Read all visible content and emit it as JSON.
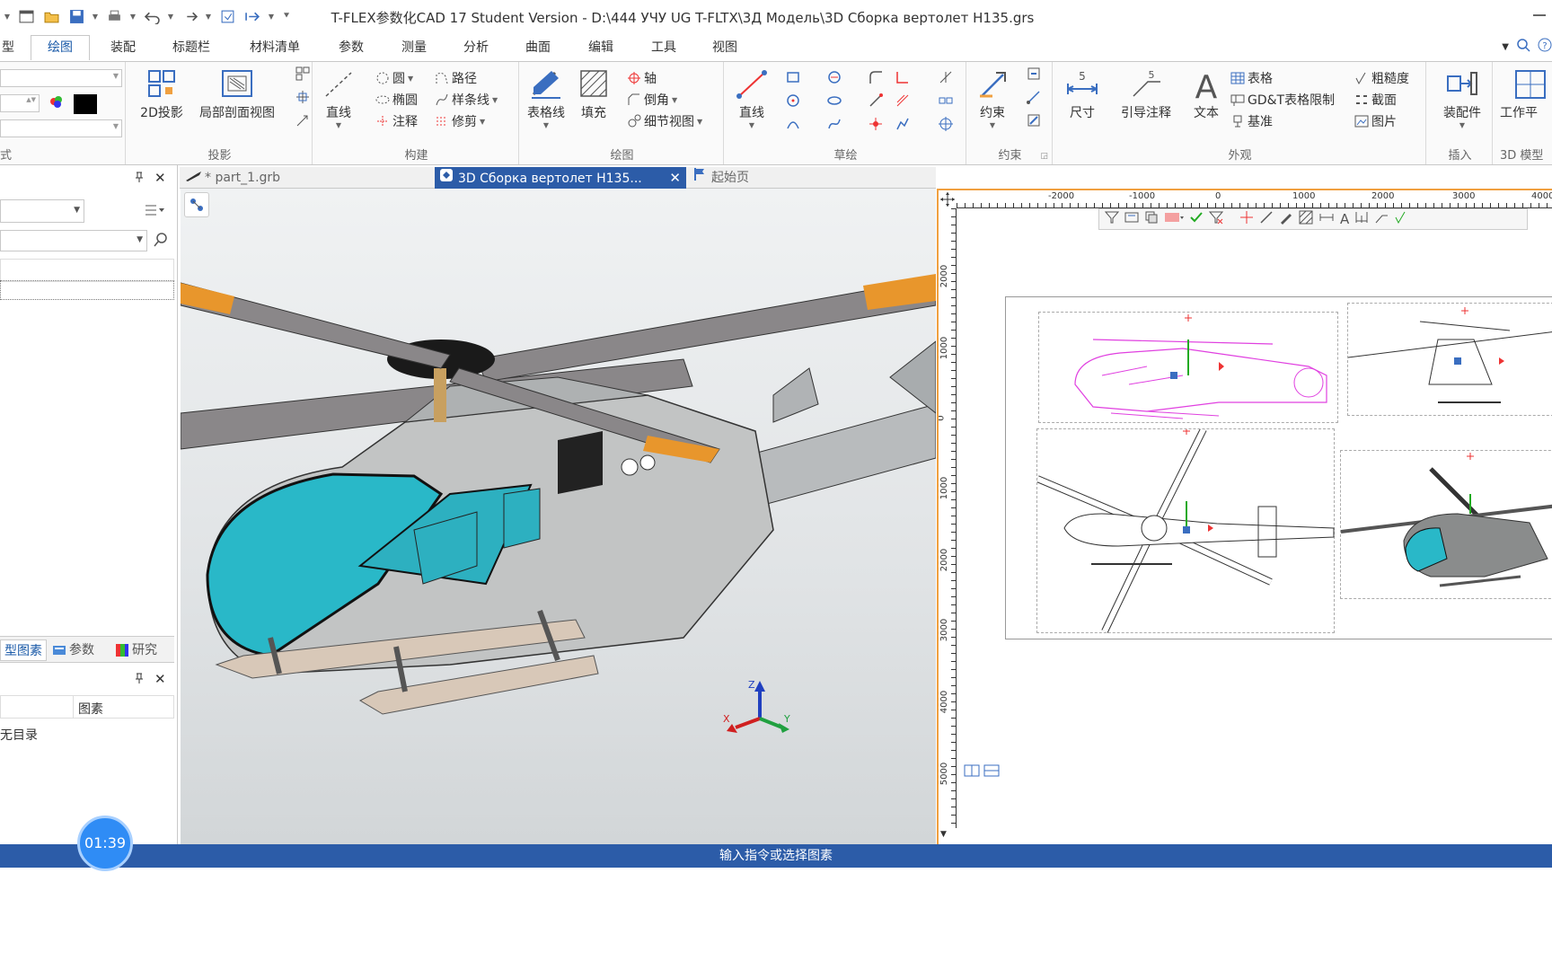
{
  "window": {
    "title": "T-FLEX参数化CAD 17 Student Version - D:\\444 УЧУ UG T-FLTX\\3Д Модель\\3D Сборка вертолет H135.grs"
  },
  "ribbon_tabs": [
    "型",
    "绘图",
    "装配",
    "标题栏",
    "材料清单",
    "参数",
    "测量",
    "分析",
    "曲面",
    "编辑",
    "工具",
    "视图"
  ],
  "ribbon": {
    "style_group": {
      "label": "式"
    },
    "projection": {
      "label": "投影",
      "btn_2d": "2D投影",
      "btn_section": "局部剖面视图"
    },
    "construct": {
      "label": "构建",
      "line": "直线",
      "circle": "圆",
      "ellipse": "椭圆",
      "annotation": "注释",
      "path": "路径",
      "spline": "样条线",
      "trim": "修剪"
    },
    "drawing": {
      "label": "绘图",
      "table_line": "表格线",
      "fill": "填充",
      "axis": "轴",
      "chamfer": "倒角",
      "detail_view": "细节视图"
    },
    "sketch": {
      "label": "草绘",
      "line": "直线"
    },
    "constraint": {
      "label": "约束",
      "btn": "约束"
    },
    "appearance": {
      "label": "外观",
      "dimension": "尺寸",
      "leader": "引导注释",
      "text": "文本",
      "table": "表格",
      "gdt": "GD&T表格限制",
      "datum": "基准",
      "roughness": "粗糙度",
      "section": "截面",
      "image": "图片"
    },
    "insert": {
      "label": "插入",
      "assembly": "装配件"
    },
    "model3d": {
      "label": "3D 模型",
      "workplane": "工作平"
    }
  },
  "doc_tabs": [
    {
      "label": "* part_1.grb",
      "active": false
    },
    {
      "label": "3D Сборка вертолет H135...",
      "active": true
    },
    {
      "label": "起始页",
      "active": false
    }
  ],
  "left_panel": {
    "bottom_tabs": [
      "型图素",
      "参数",
      "研究"
    ],
    "column_header": "图素",
    "empty_text": "无目录"
  },
  "ruler": {
    "h_ticks": [
      "-2000",
      "-1000",
      "0",
      "1000",
      "2000",
      "3000",
      "4000"
    ],
    "v_ticks": [
      "2000",
      "1000",
      "0",
      "1000",
      "2000",
      "3000",
      "4000",
      "5000"
    ]
  },
  "axes": {
    "x": "X",
    "y": "Y",
    "z": "Z"
  },
  "status": {
    "prompt": "输入指令或选择图素"
  },
  "timer": "01:39",
  "colors": {
    "accent": "#2c5ca8",
    "highlight": "#f0a040",
    "canopy": "#29b8c8",
    "magenta": "#e040e0"
  }
}
